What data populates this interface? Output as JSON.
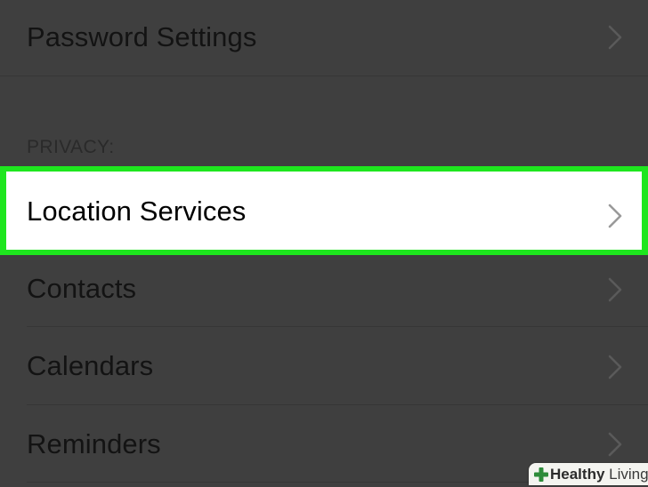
{
  "rows": {
    "password_settings": "Password Settings",
    "location_services": "Location Services",
    "contacts": "Contacts",
    "calendars": "Calendars",
    "reminders": "Reminders"
  },
  "section_header": "PRIVACY:",
  "watermark": {
    "bold": "Healthy",
    "light": " Living"
  },
  "colors": {
    "background": "#3f3f3f",
    "highlight_border": "#1ee61e",
    "highlight_fill": "#ffffff",
    "chevron": "#5a5a5a",
    "watermark_cross": "#2e8b3a"
  },
  "icons": {
    "row_chevron": "chevron-right-icon",
    "watermark_logo": "plus-cross-icon"
  }
}
